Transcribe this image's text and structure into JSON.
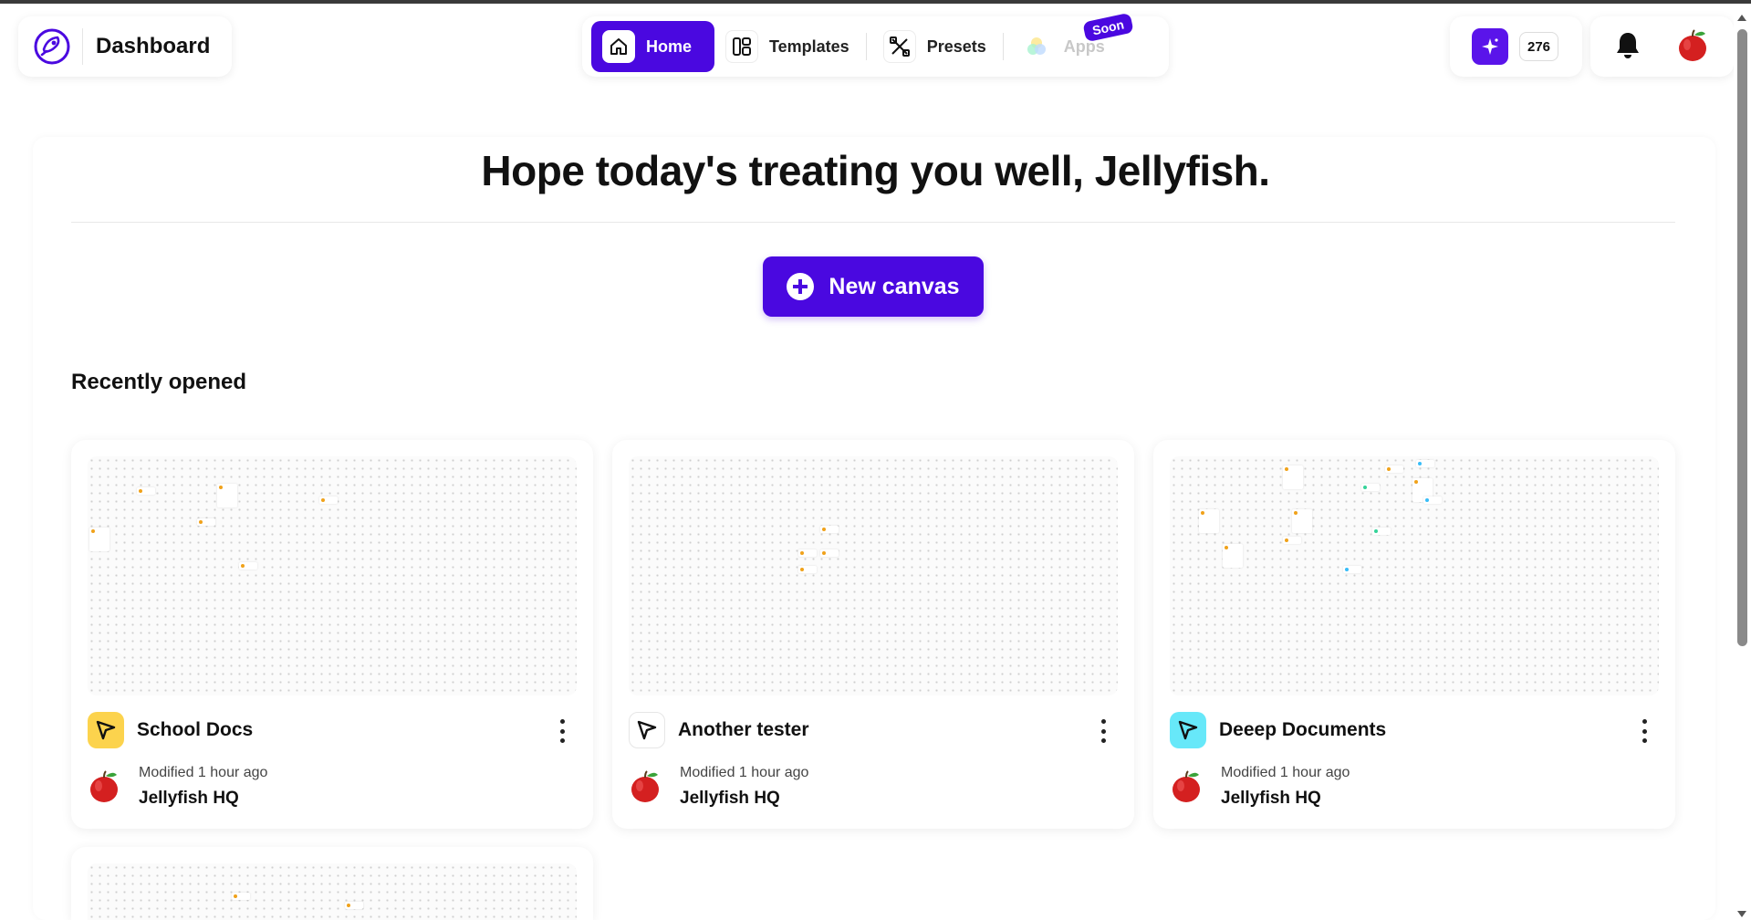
{
  "brand": {
    "title": "Dashboard"
  },
  "nav": {
    "items": [
      {
        "label": "Home",
        "icon": "home-icon",
        "active": true
      },
      {
        "label": "Templates",
        "icon": "layout-icon"
      },
      {
        "label": "Presets",
        "icon": "tools-icon"
      },
      {
        "label": "Apps",
        "icon": "apps-icon",
        "badge": "Soon"
      }
    ]
  },
  "credits": {
    "count": "276"
  },
  "main": {
    "greeting": "Hope today's treating you well, Jellyfish.",
    "new_canvas_label": "New canvas",
    "recent_title": "Recently opened"
  },
  "cards": [
    {
      "title": "School Docs",
      "modified": "Modified 1 hour ago",
      "owner": "Jellyfish HQ",
      "icon_color": "#fcd34d"
    },
    {
      "title": "Another tester",
      "modified": "Modified 1 hour ago",
      "owner": "Jellyfish HQ",
      "icon_color": "#ffffff"
    },
    {
      "title": "Deeep Documents",
      "modified": "Modified 1 hour ago",
      "owner": "Jellyfish HQ",
      "icon_color": "#67e8f9"
    }
  ],
  "colors": {
    "accent": "#4a08e0"
  }
}
